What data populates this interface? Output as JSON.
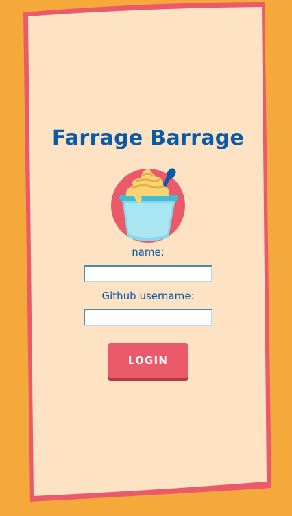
{
  "page": {
    "title": "Farrage Barrage"
  },
  "logo": {
    "icon": "ice-cream-cup-icon"
  },
  "form": {
    "name_label": "name:",
    "name_value": "",
    "github_label": "Github username:",
    "github_value": "",
    "login_label": "LOGIN"
  },
  "colors": {
    "background": "#f5a93a",
    "card": "#fde3c4",
    "card_border": "#ea5a6b",
    "title": "#0b5aa6",
    "button": "#ea5a6b",
    "button_shadow": "#b53a45"
  }
}
